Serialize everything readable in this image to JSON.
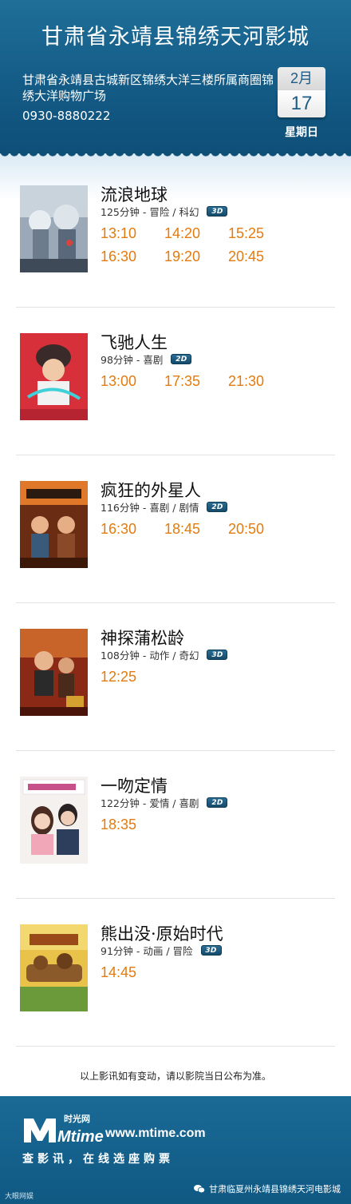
{
  "header": {
    "cinema_name": "甘肃省永靖县锦绣天河影城",
    "address": "甘肃省永靖县古城新区锦绣大洋三楼所属商圈锦绣大洋购物广场",
    "phone": "0930-8880222",
    "month": "2月",
    "day": "17",
    "weekday": "星期日"
  },
  "movies": [
    {
      "title": "流浪地球",
      "info": "125分钟 - 冒险 / 科幻",
      "format": "3D",
      "times": [
        "13:10",
        "14:20",
        "15:25",
        "16:30",
        "19:20",
        "20:45"
      ]
    },
    {
      "title": "飞驰人生",
      "info": "98分钟 - 喜剧",
      "format": "2D",
      "times": [
        "13:00",
        "17:35",
        "21:30"
      ]
    },
    {
      "title": "疯狂的外星人",
      "info": "116分钟 - 喜剧 / 剧情",
      "format": "2D",
      "times": [
        "16:30",
        "18:45",
        "20:50"
      ]
    },
    {
      "title": "神探蒲松龄",
      "info": "108分钟 - 动作 / 奇幻",
      "format": "3D",
      "times": [
        "12:25"
      ]
    },
    {
      "title": "一吻定情",
      "info": "122分钟 - 爱情 / 喜剧",
      "format": "2D",
      "times": [
        "18:35"
      ]
    },
    {
      "title": "熊出没·原始时代",
      "info": "91分钟 - 动画 / 冒险",
      "format": "3D",
      "times": [
        "14:45"
      ]
    }
  ],
  "notice": "以上影讯如有变动，请以影院当日公布为准。",
  "footer": {
    "logo_text": "Mtime",
    "logo_sub": "时光网",
    "site_url": "www.mtime.com",
    "slogan": "查影讯，在线选座购票",
    "watermark_left": "大眼网娱",
    "wechat_account": "甘肃临夏州永靖县锦绣天河电影城"
  },
  "colors": {
    "header_blue": "#135a85",
    "time_orange": "#e27b10",
    "badge_blue": "#1f5f86"
  }
}
